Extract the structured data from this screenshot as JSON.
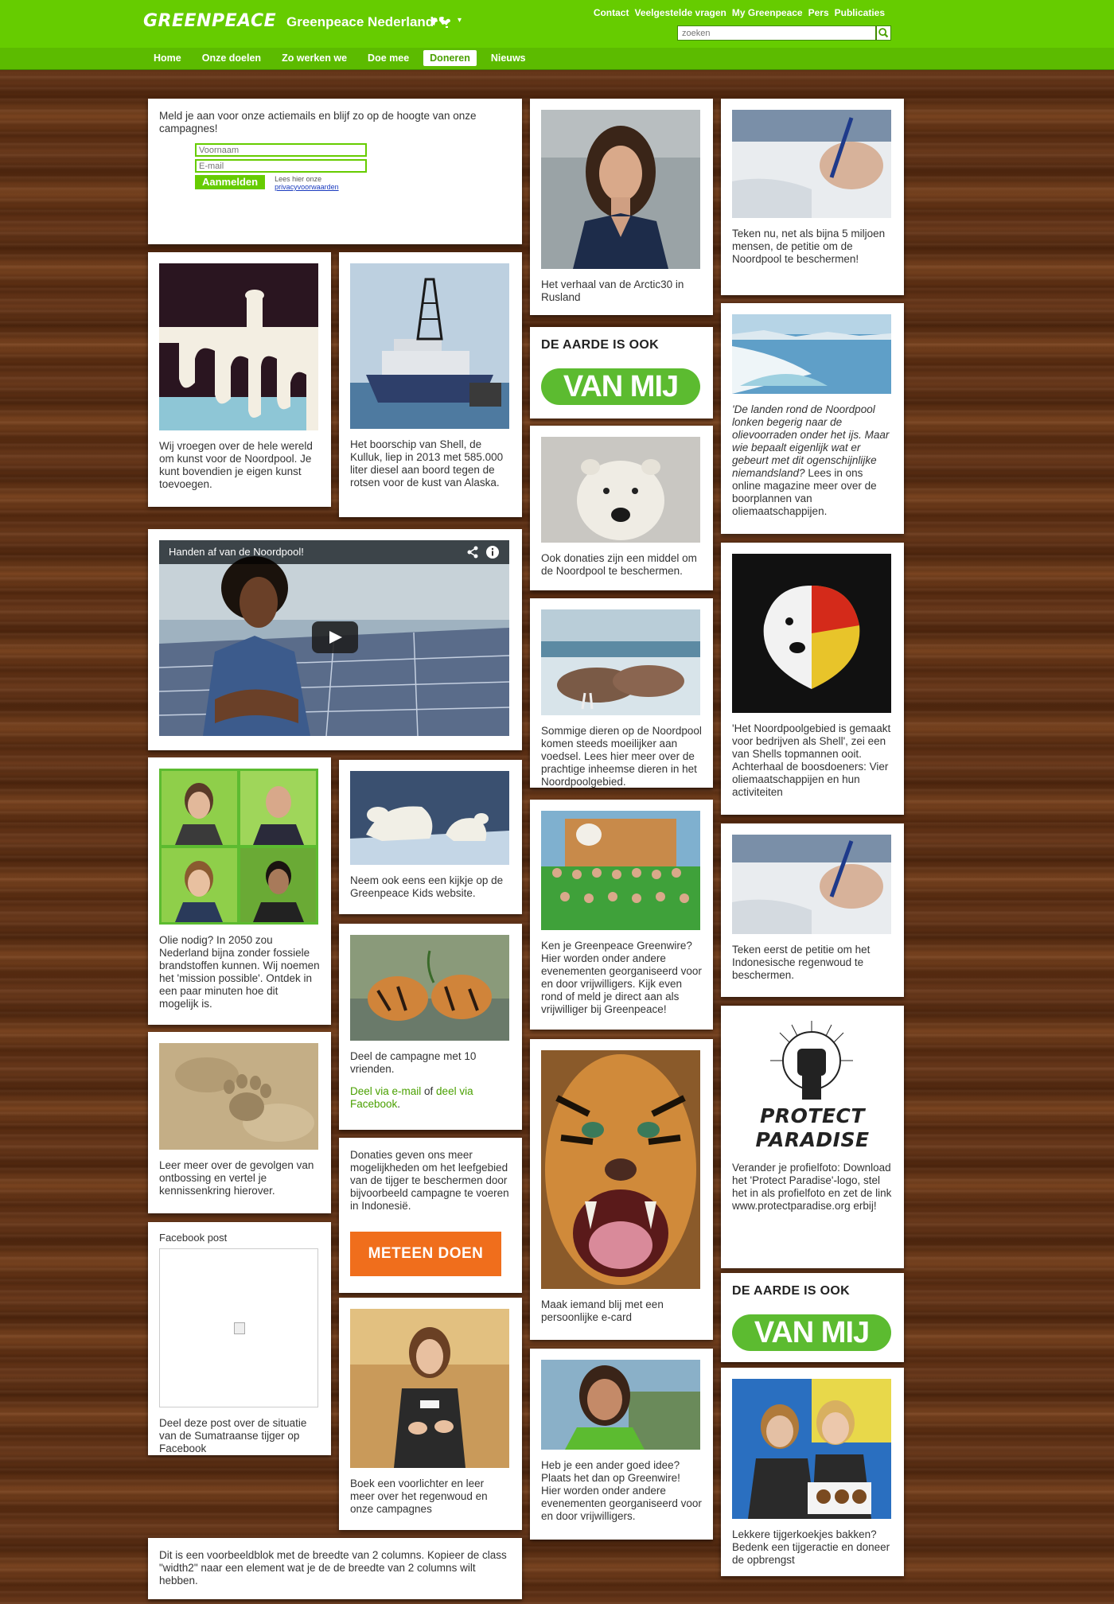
{
  "header": {
    "logo": "GREENPEACE",
    "site_name": "Greenpeace Nederland",
    "caret": "▾",
    "top_links": [
      "Contact",
      "Veelgestelde vragen",
      "My Greenpeace",
      "Pers",
      "Publicaties"
    ],
    "search_placeholder": "zoeken",
    "nav": [
      "Home",
      "Onze doelen",
      "Zo werken we",
      "Doe mee",
      "Doneren",
      "Nieuws"
    ],
    "active_nav": "Doneren"
  },
  "colors": {
    "brand_green": "#66cc00",
    "action_orange": "#f06e1c",
    "link_green": "#4aa000"
  },
  "signup": {
    "text": "Meld je aan voor onze actiemails en blijf zo op de hoogte van onze campagnes!",
    "firstname_placeholder": "Voornaam",
    "email_placeholder": "E-mail",
    "button": "Aanmelden",
    "privacy_line1": "Lees hier onze",
    "privacy_link": "privacyvoorwaarden"
  },
  "cards": {
    "arctic30": "Het verhaal van de Arctic30 in Rusland",
    "petition_5m": "Teken nu, net als bijna 5 miljoen mensen, de petitie om de Noordpool te beschermen!",
    "art": "Wij vroegen over de hele wereld om kunst voor de Noordpool. Je kunt bovendien je eigen kunst toevoegen.",
    "kulluk": "Het boorschip van Shell, de Kulluk, liep in 2013 met 585.000 liter diesel aan boord tegen de rotsen voor de kust van Alaska.",
    "aarde_title_1": "DE AARDE IS OOK",
    "vanmij_1": "VAN MIJ",
    "landen_italic": "'De landen rond de Noordpool lonken begerig naar de olievoorraden onder het ijs. Maar wie bepaalt eigenlijk wat er gebeurt met dit ogenschijnlijke niemandsland?",
    "landen_rest": " Lees in ons online magazine meer over de boorplannen van oliemaatschappijen.",
    "donaties_noordpool": "Ook donaties zijn een middel om de Noordpool te beschermen.",
    "video_title": "Handen af van de Noordpool!",
    "walrus": "Sommige dieren op de Noordpool komen steeds moeilijker aan voedsel. Lees hier meer over de prachtige inheemse dieren in het Noordpoolgebied.",
    "shell_quote": "'Het Noordpoolgebied is gemaakt voor bedrijven als Shell', zei een van Shells topmannen ooit. Achterhaal de boosdoeners: Vier oliemaatschappijen en hun activiteiten",
    "olie": "Olie nodig? In 2050 zou Nederland bijna zonder fossiele brandstoffen kunnen. Wij noemen het 'mission possible'. Ontdek in een paar minuten hoe dit mogelijk is.",
    "kids": "Neem ook eens een kijkje op de Greenpeace Kids website.",
    "greenwire": "Ken je Greenpeace Greenwire? Hier worden onder andere evenementen georganiseerd voor en door vrijwilligers. Kijk even rond of meld je direct aan als vrijwilliger bij Greenpeace!",
    "petitie_regenwoud": "Teken eerst de petitie om het Indonesische regenwoud te beschermen.",
    "deel_campagne": "Deel de campagne met 10 vrienden.",
    "deel_email": "Deel via e-mail",
    "deel_of": " of ",
    "deel_facebook": "deel via Facebook",
    "deel_end": ".",
    "ontbossing": "Leer meer over de gevolgen van ontbossing en vertel je kennissenkring hierover.",
    "tijger_donaties": "Donaties geven ons meer mogelijkheden om het leefgebied van de tijger te beschermen door bijvoorbeeld campagne te voeren in Indonesië.",
    "meteen_doen": "METEEN DOEN",
    "ecard": "Maak iemand blij met een persoonlijke e-card",
    "pp_line1": "PROTECT",
    "pp_line2": "PARADISE",
    "pp_text": "Verander je profielfoto: Download het 'Protect Paradise'-logo, stel het in als profielfoto en zet de link www.protectparadise.org erbij!",
    "fb_label": "Facebook post",
    "fb_text": "Deel deze post over de situatie van de Sumatraanse tijger op Facebook",
    "aarde_title_2": "DE AARDE IS OOK",
    "vanmij_2": "VAN MIJ",
    "voorlichter": "Boek een voorlichter en leer meer over het regenwoud en onze campagnes",
    "goed_idee": "Heb je een ander goed idee? Plaats het dan op Greenwire! Hier worden onder andere evenementen georganiseerd voor en door vrijwilligers.",
    "koekjes": "Lekkere tijgerkoekjes bakken? Bedenk een tijgeractie en doneer de opbrengst",
    "voorbeeld": "Dit is een voorbeeldblok met de breedte van 2 columns. Kopieer de class \"width2\" naar een element wat je de de breedte van 2 columns wilt hebben."
  }
}
